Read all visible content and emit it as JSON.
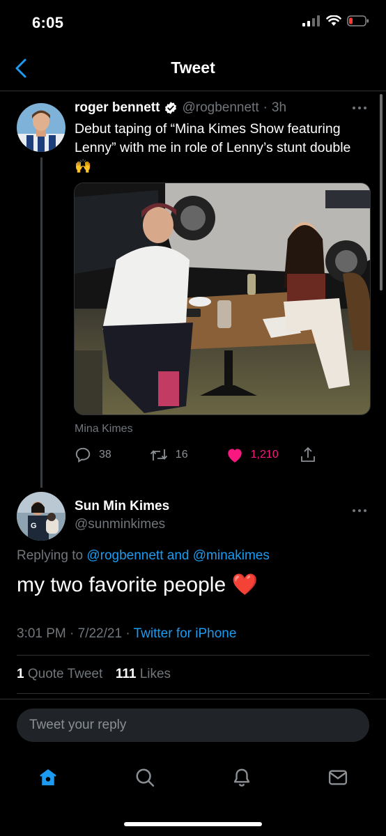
{
  "status_bar": {
    "time": "6:05"
  },
  "header": {
    "title": "Tweet"
  },
  "parent_tweet": {
    "name": "roger bennett",
    "handle": "@rogbennett",
    "separator": "·",
    "time": "3h",
    "text": "Debut taping of “Mina Kimes Show featuring Lenny” with me in role of Lenny’s stunt double 🙌",
    "media_caption": "Mina Kimes",
    "actions": {
      "replies": "38",
      "retweets": "16",
      "likes": "1,210"
    }
  },
  "main_tweet": {
    "name": "Sun Min Kimes",
    "handle": "@sunminkimes",
    "replying_prefix": "Replying to",
    "replying_user1": "@rogbennett",
    "replying_and": "and",
    "replying_user2": "@minakimes",
    "text": "my two favorite people ❤️",
    "timestamp": "3:01 PM · 7/22/21 ·",
    "source": "Twitter for iPhone",
    "stats": {
      "quote_count": "1",
      "quote_label": "Quote Tweet",
      "like_count": "111",
      "like_label": "Likes"
    }
  },
  "reply": {
    "placeholder": "Tweet your reply"
  },
  "colors": {
    "accent": "#1d9bf0",
    "like": "#f91880",
    "battery": "#ff3b30"
  },
  "icons": [
    "back-icon",
    "verified-icon",
    "more-icon",
    "reply-icon",
    "retweet-icon",
    "like-icon",
    "share-icon",
    "home-icon",
    "search-icon",
    "notifications-icon",
    "messages-icon"
  ]
}
